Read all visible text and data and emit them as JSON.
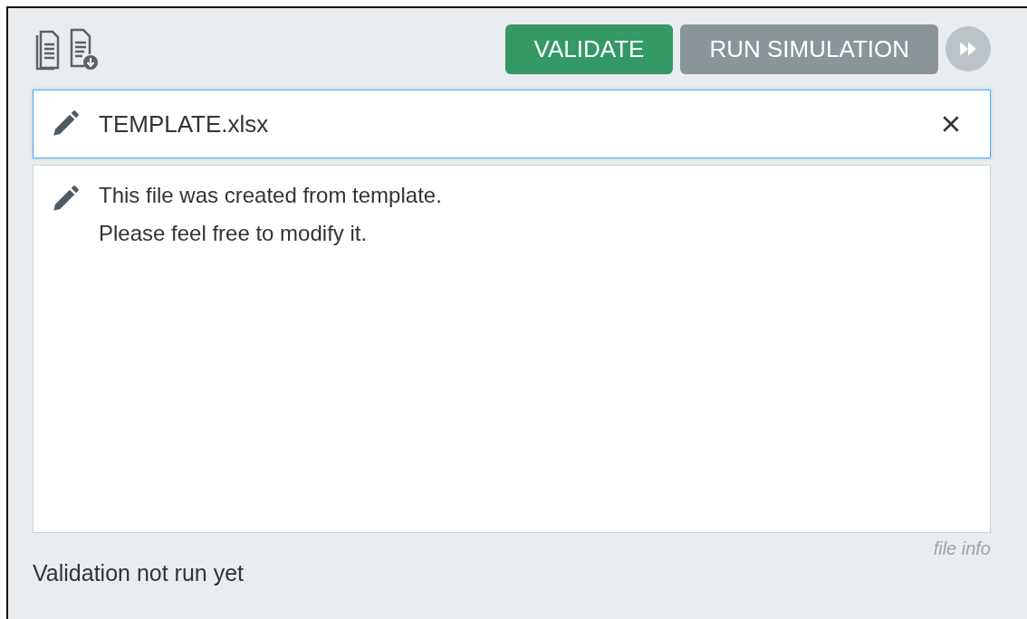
{
  "toolbar": {
    "buttons": [
      {
        "kind": "text",
        "label": "VALIDATE",
        "disabled": false
      },
      {
        "kind": "text",
        "label": "RUN SIMULATION",
        "disabled": true
      },
      {
        "kind": "round",
        "disabled": true
      }
    ]
  },
  "file_name": {
    "value": "TEMPLATE.xlsx"
  },
  "description": {
    "lines": [
      "This file was created from template.",
      "Please feel free to modify it."
    ]
  },
  "file_info_label": "file info",
  "status": "Validation not run yet"
}
